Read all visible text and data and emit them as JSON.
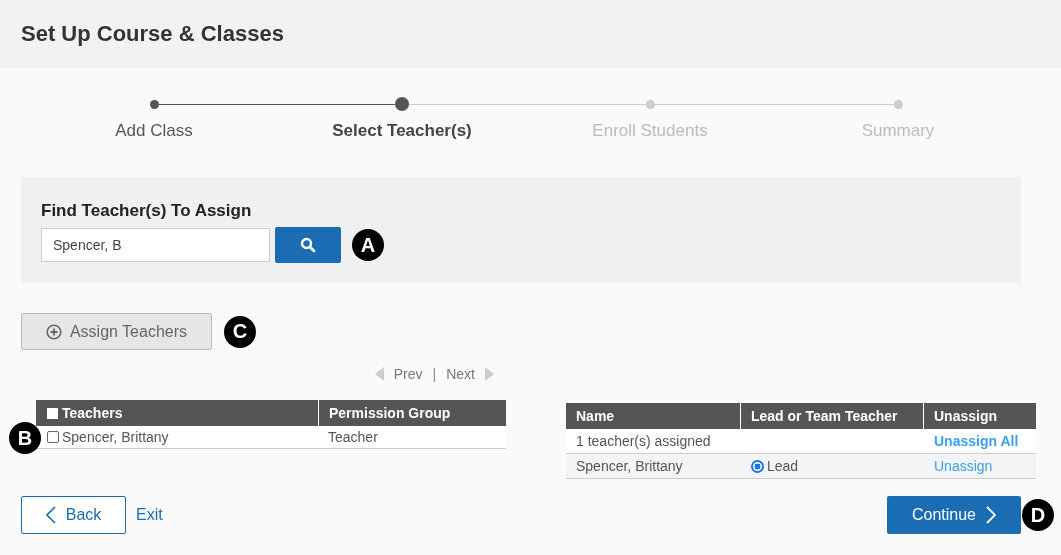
{
  "page": {
    "title": "Set Up Course & Classes"
  },
  "steps": [
    {
      "label": "Add Class",
      "kind": "done"
    },
    {
      "label": "Select Teacher(s)",
      "kind": "current"
    },
    {
      "label": "Enroll Students",
      "kind": "upcoming"
    },
    {
      "label": "Summary",
      "kind": "upcoming"
    }
  ],
  "search": {
    "title": "Find Teacher(s) To Assign",
    "value": "Spencer, B",
    "callout": "A"
  },
  "assign_button": {
    "label": "Assign Teachers",
    "callout": "C"
  },
  "pager": {
    "prev": "Prev",
    "separator": "|",
    "next": "Next"
  },
  "teachers_table": {
    "columns": [
      "Teachers",
      "Permission Group"
    ],
    "select_all_checked": false,
    "callout": "B",
    "rows": [
      {
        "name": "Spencer, Brittany",
        "group": "Teacher",
        "checked": false
      }
    ]
  },
  "assigned_table": {
    "columns": [
      "Name",
      "Lead or Team Teacher",
      "Unassign"
    ],
    "summary": "1 teacher(s) assigned",
    "unassign_all": "Unassign All",
    "rows": [
      {
        "name": "Spencer, Brittany",
        "role": "Lead",
        "lead": true,
        "unassign": "Unassign"
      }
    ]
  },
  "footer": {
    "back": "Back",
    "exit": "Exit",
    "continue": "Continue",
    "callout": "D"
  }
}
